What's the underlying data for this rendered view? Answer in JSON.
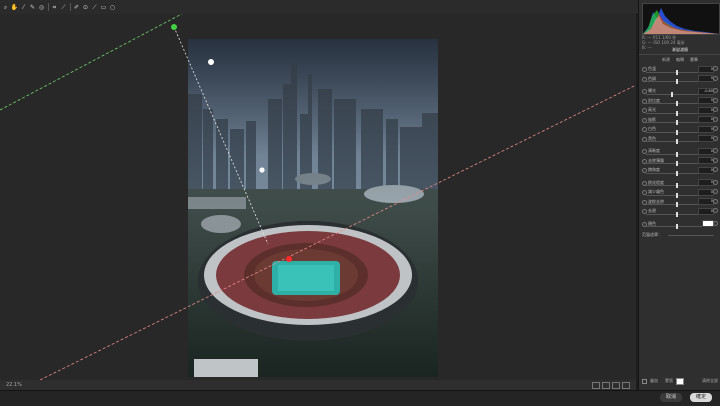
{
  "toolbar": {
    "tools": [
      {
        "name": "zoom-tool",
        "icon": "magnifier-icon",
        "glyph": "⌕"
      },
      {
        "name": "hand-tool",
        "icon": "hand-icon",
        "glyph": "✋"
      },
      {
        "name": "white-balance-tool",
        "icon": "eyedropper-icon",
        "glyph": "⁄"
      },
      {
        "name": "color-sampler-tool",
        "icon": "sampler-icon",
        "glyph": "✎"
      },
      {
        "name": "targeted-adjust-tool",
        "icon": "target-icon",
        "glyph": "◎"
      },
      {
        "name": "crop-tool",
        "icon": "crop-icon",
        "glyph": "⌗"
      },
      {
        "name": "straighten-tool",
        "icon": "ruler-icon",
        "glyph": "⟋"
      },
      {
        "name": "spot-removal-tool",
        "icon": "brush-icon",
        "glyph": "✐"
      },
      {
        "name": "red-eye-tool",
        "icon": "eye-icon",
        "glyph": "⊙"
      },
      {
        "name": "adjustment-brush-tool",
        "icon": "paintbrush-icon",
        "glyph": "⟋"
      },
      {
        "name": "graduated-filter-tool",
        "icon": "gradient-icon",
        "glyph": "▭"
      },
      {
        "name": "radial-filter-tool",
        "icon": "circle-icon",
        "glyph": "○"
      }
    ],
    "preview_icon": "preview-toggle-icon"
  },
  "canvas": {
    "zoom_label": "22.1%"
  },
  "footer": {
    "cancel_label": "取消",
    "ok_label": "確定"
  },
  "panel": {
    "info_lines": [
      "R: ---  f/11  1/60 秒",
      "G: ---  ISO 100  24 毫米",
      "B: ---"
    ],
    "section_title": "漸變濾鏡",
    "modes": [
      "新建",
      "編輯",
      "畫筆"
    ],
    "sliders": [
      {
        "label": "色溫",
        "value": "0",
        "pos": 0.5
      },
      {
        "label": "色調",
        "value": "0",
        "pos": 0.5
      },
      {
        "label": "曝光",
        "value": "-0.60",
        "pos": 0.42
      },
      {
        "label": "對比度",
        "value": "0",
        "pos": 0.5
      },
      {
        "label": "高光",
        "value": "0",
        "pos": 0.5
      },
      {
        "label": "陰影",
        "value": "0",
        "pos": 0.5
      },
      {
        "label": "白色",
        "value": "0",
        "pos": 0.5
      },
      {
        "label": "黑色",
        "value": "0",
        "pos": 0.5
      },
      {
        "label": "清晰度",
        "value": "0",
        "pos": 0.5
      },
      {
        "label": "去除薄霧",
        "value": "0",
        "pos": 0.5
      },
      {
        "label": "飽和度",
        "value": "0",
        "pos": 0.5
      },
      {
        "label": "銳化程度",
        "value": "0",
        "pos": 0.5
      },
      {
        "label": "減少雜色",
        "value": "0",
        "pos": 0.5
      },
      {
        "label": "波紋去除",
        "value": "0",
        "pos": 0.5
      },
      {
        "label": "去邊",
        "value": "0",
        "pos": 0.5
      },
      {
        "label": "顏色",
        "value": "",
        "pos": 0.5
      }
    ],
    "range_label": "范圍遮罩：",
    "bottom": {
      "overlay_label": "疊加",
      "mask_label": "蒙版",
      "clear_label": "清除全部"
    }
  }
}
